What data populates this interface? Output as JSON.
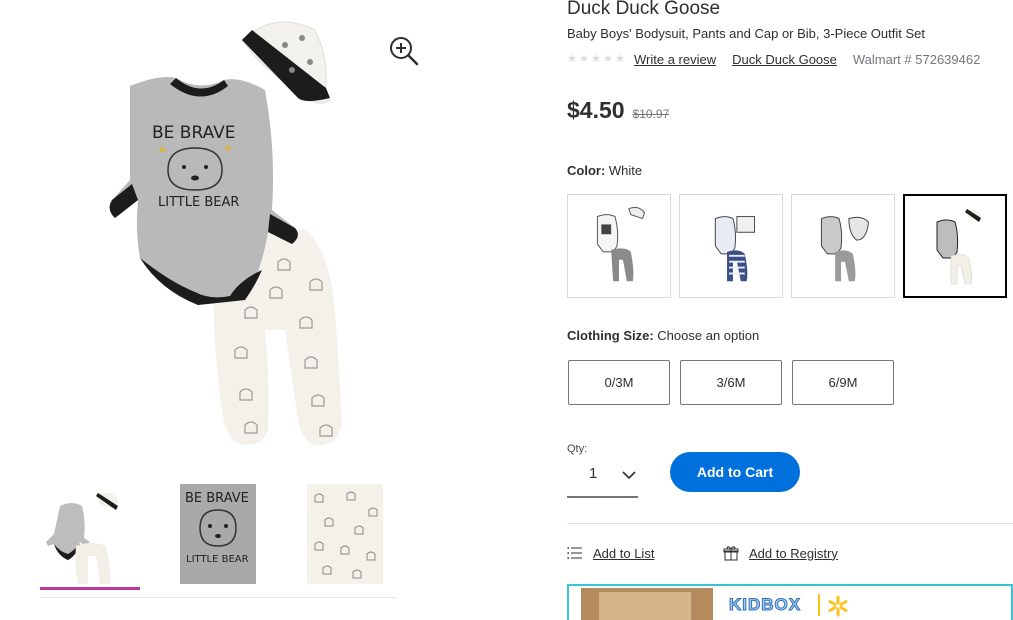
{
  "product": {
    "brand_title": "Duck Duck Goose",
    "subtitle": "Baby Boys' Bodysuit, Pants and Cap or Bib, 3-Piece Outfit Set",
    "review_link": "Write a review",
    "brand_link": "Duck Duck Goose",
    "walmart_number": "Walmart # 572639462",
    "rating_stars": 0,
    "price": "$4.50",
    "was_price": "$10.97"
  },
  "color": {
    "label": "Color:",
    "selected_value": "White",
    "swatch_count": 4,
    "selected_index": 3
  },
  "size": {
    "label": "Clothing Size:",
    "prompt": "Choose an option",
    "options": [
      "0/3M",
      "3/6M",
      "6/9M"
    ]
  },
  "quantity": {
    "label": "Qty:",
    "value": "1"
  },
  "actions": {
    "add_to_cart": "Add to Cart",
    "add_to_list": "Add to List",
    "add_to_registry": "Add to Registry"
  },
  "image": {
    "bodysuit_text_line1": "BE BRAVE",
    "bodysuit_text_line2": "LITTLE BEAR"
  },
  "promo": {
    "brand": "KIDBOX"
  },
  "colors": {
    "accent_blue": "#0071dc",
    "thumb_indicator": "#c0379c",
    "promo_border": "#39c4d6",
    "selected_border": "#000000"
  },
  "icons": [
    "zoom-in-icon",
    "chevron-down-icon",
    "list-icon",
    "gift-icon",
    "walmart-spark-icon",
    "star-icon"
  ]
}
